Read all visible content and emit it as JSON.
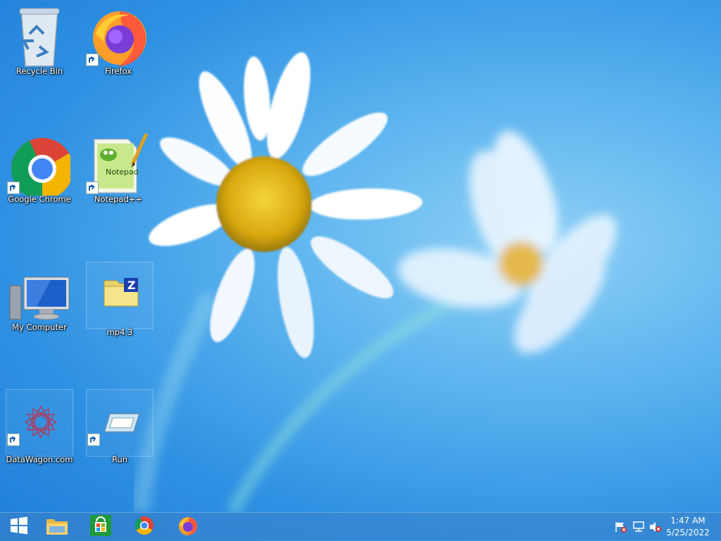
{
  "desktop": {
    "icons": [
      {
        "label": "Recycle Bin"
      },
      {
        "label": "Firefox"
      },
      {
        "label": "Google Chrome"
      },
      {
        "label": "Notepad++"
      },
      {
        "label": "My Computer"
      },
      {
        "label": "mp4.3"
      },
      {
        "label": "DataWagon.com"
      },
      {
        "label": "Run"
      }
    ]
  },
  "taskbar": {
    "pinned": [
      "start-icon",
      "file-explorer-icon",
      "store-icon",
      "chrome-icon",
      "firefox-icon"
    ],
    "tray": [
      "action-center-flag-icon",
      "network-icon",
      "volume-muted-icon"
    ],
    "clock": {
      "time": "1:47 AM",
      "date": "5/25/2022"
    }
  },
  "colors": {
    "taskbar": "#3c82c8",
    "wallpaper": "#2f91e3"
  }
}
